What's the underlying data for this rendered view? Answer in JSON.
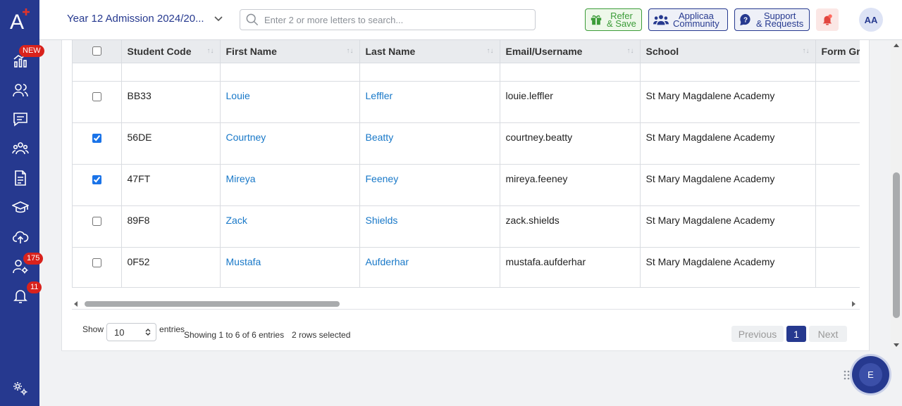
{
  "sidebar": {
    "logo_letter": "A",
    "items": [
      {
        "icon": "dashboard-chart-icon",
        "badge": "NEW"
      },
      {
        "icon": "users-icon",
        "badge": ""
      },
      {
        "icon": "chat-icon",
        "badge": ""
      },
      {
        "icon": "group-icon",
        "badge": ""
      },
      {
        "icon": "document-icon",
        "badge": ""
      },
      {
        "icon": "graduation-cap-icon",
        "badge": ""
      },
      {
        "icon": "cloud-upload-icon",
        "badge": ""
      },
      {
        "icon": "user-settings-icon",
        "badge": "175"
      },
      {
        "icon": "bell-icon",
        "badge": "11"
      },
      {
        "icon": "settings-gears-icon",
        "badge": ""
      }
    ]
  },
  "header": {
    "year_select": "Year 12 Admission 2024/20...",
    "search_placeholder": "Enter 2 or more letters to search...",
    "refer_line1": "Refer",
    "refer_line2": "& Save",
    "community_line1": "Applicaa",
    "community_line2": "Community",
    "support_line1": "Support",
    "support_line2": "& Requests",
    "avatar_initials": "AA"
  },
  "table": {
    "columns": [
      "Student Code",
      "First Name",
      "Last Name",
      "Email/Username",
      "School",
      "Form Gr"
    ],
    "rows": [
      {
        "checked": false,
        "code": "BB33",
        "first": "Louie",
        "last": "Leffler",
        "email": "louie.leffler",
        "school": "St Mary Magdalene Academy",
        "form": ""
      },
      {
        "checked": true,
        "code": "56DE",
        "first": "Courtney",
        "last": "Beatty",
        "email": "courtney.beatty",
        "school": "St Mary Magdalene Academy",
        "form": ""
      },
      {
        "checked": true,
        "code": "47FT",
        "first": "Mireya",
        "last": "Feeney",
        "email": "mireya.feeney",
        "school": "St Mary Magdalene Academy",
        "form": ""
      },
      {
        "checked": false,
        "code": "89F8",
        "first": "Zack",
        "last": "Shields",
        "email": "zack.shields",
        "school": "St Mary Magdalene Academy",
        "form": ""
      },
      {
        "checked": false,
        "code": "0F52",
        "first": "Mustafa",
        "last": "Aufderhar",
        "email": "mustafa.aufderhar",
        "school": "St Mary Magdalene Academy",
        "form": ""
      }
    ]
  },
  "footer": {
    "show_label": "Show",
    "entries_value": "10",
    "entries_label": "entries",
    "info": "Showing 1 to 6 of 6 entries",
    "selected": "2 rows selected",
    "previous": "Previous",
    "current_page": "1",
    "next": "Next"
  },
  "fab_letter": "E",
  "colors": {
    "sidebar": "#26398f",
    "badge": "#d9221c",
    "link": "#1878c8",
    "refer_green": "#3c9c39"
  }
}
